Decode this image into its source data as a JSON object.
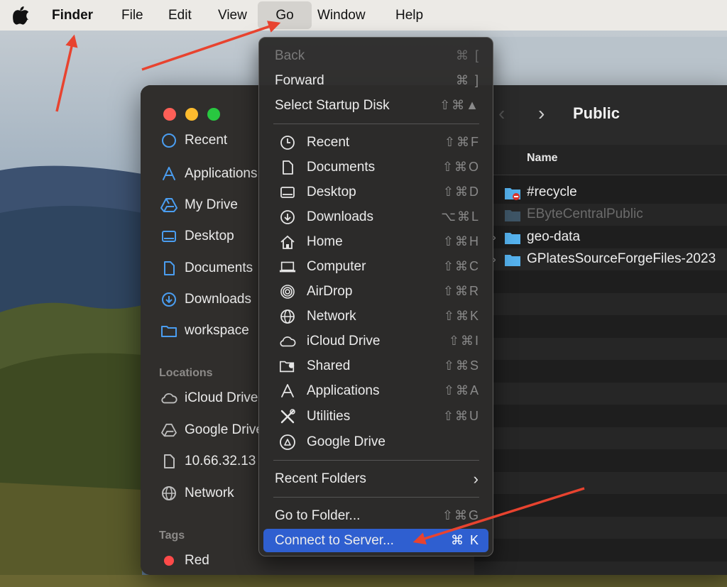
{
  "menubar": {
    "apple": "",
    "finder": "Finder",
    "file": "File",
    "edit": "Edit",
    "view": "View",
    "go": "Go",
    "window": "Window",
    "help": "Help"
  },
  "sidebar": {
    "favorites": [
      {
        "label": "Recent",
        "icon": "clock-icon"
      },
      {
        "label": "Applications",
        "icon": "applications-icon"
      },
      {
        "label": "My Drive",
        "icon": "google-drive-icon"
      },
      {
        "label": "Desktop",
        "icon": "desktop-icon"
      },
      {
        "label": "Documents",
        "icon": "document-icon"
      },
      {
        "label": "Downloads",
        "icon": "download-icon"
      },
      {
        "label": "workspace",
        "icon": "folder-icon"
      }
    ],
    "locations_heading": "Locations",
    "locations": [
      {
        "label": "iCloud Drive",
        "icon": "cloud-icon"
      },
      {
        "label": "Google Drive",
        "icon": "google-drive-icon"
      },
      {
        "label": "10.66.32.13",
        "icon": "document-icon"
      },
      {
        "label": "Network",
        "icon": "globe-icon"
      }
    ],
    "tags_heading": "Tags",
    "tags": [
      {
        "label": "Red",
        "color": "#fe4a49"
      }
    ]
  },
  "window": {
    "title": "Public",
    "back": "‹",
    "forward": "›",
    "column_name": "Name",
    "rows": [
      {
        "name": "#recycle",
        "dim": false,
        "chevron": false
      },
      {
        "name": "EByteCentralPublic",
        "dim": true,
        "chevron": false
      },
      {
        "name": "geo-data",
        "dim": false,
        "chevron": true
      },
      {
        "name": "GPlatesSourceForgeFiles-2023",
        "dim": false,
        "chevron": true
      }
    ]
  },
  "go_menu": {
    "back": {
      "label": "Back",
      "shortcut": "⌘ ["
    },
    "forward": {
      "label": "Forward",
      "shortcut": "⌘ ]"
    },
    "startup": {
      "label": "Select Startup Disk",
      "shortcut": "⇧⌘▲"
    },
    "recent": {
      "label": "Recent",
      "shortcut": "⇧⌘F"
    },
    "documents": {
      "label": "Documents",
      "shortcut": "⇧⌘O"
    },
    "desktop": {
      "label": "Desktop",
      "shortcut": "⇧⌘D"
    },
    "downloads": {
      "label": "Downloads",
      "shortcut": "⌥⌘L"
    },
    "home": {
      "label": "Home",
      "shortcut": "⇧⌘H"
    },
    "computer": {
      "label": "Computer",
      "shortcut": "⇧⌘C"
    },
    "airdrop": {
      "label": "AirDrop",
      "shortcut": "⇧⌘R"
    },
    "network": {
      "label": "Network",
      "shortcut": "⇧⌘K"
    },
    "icloud": {
      "label": "iCloud Drive",
      "shortcut": "⇧⌘I"
    },
    "shared": {
      "label": "Shared",
      "shortcut": "⇧⌘S"
    },
    "applications": {
      "label": "Applications",
      "shortcut": "⇧⌘A"
    },
    "utilities": {
      "label": "Utilities",
      "shortcut": "⇧⌘U"
    },
    "gdrive": {
      "label": "Google Drive",
      "shortcut": ""
    },
    "recent_folders": {
      "label": "Recent Folders",
      "shortcut": "›"
    },
    "go_to_folder": {
      "label": "Go to Folder...",
      "shortcut": "⇧⌘G"
    },
    "connect": {
      "label": "Connect to Server...",
      "shortcut": "⌘ K"
    }
  },
  "colors": {
    "highlight": "#2f5fd0",
    "annotation_arrow": "#e8432f",
    "folder_blue": "#55b2ee"
  }
}
